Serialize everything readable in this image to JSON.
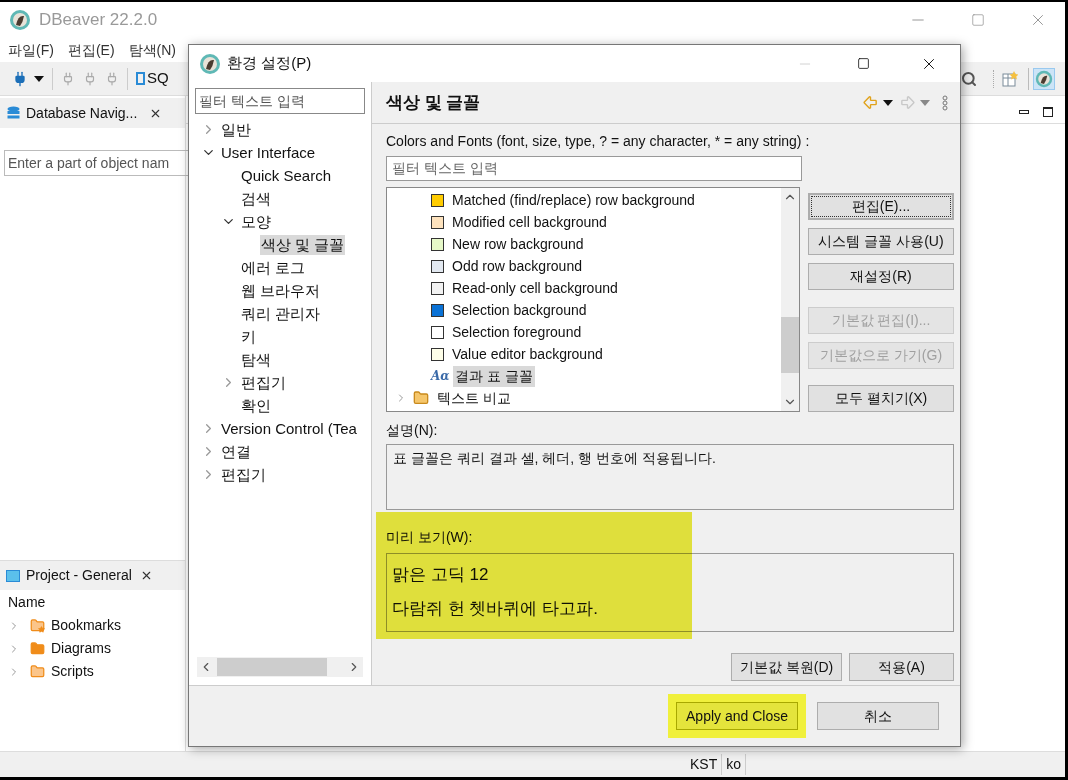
{
  "app": {
    "title": "DBeaver 22.2.0",
    "menu": [
      "파일(F)",
      "편집(E)",
      "탐색(N)"
    ],
    "toolbar_label": "SQ"
  },
  "navigator": {
    "tab": "Database Navig...",
    "filter_placeholder": "Enter a part of object nam"
  },
  "project": {
    "tab": "Project - General",
    "column": "Name",
    "items": [
      {
        "label": "Bookmarks",
        "kind": "bookmarks"
      },
      {
        "label": "Diagrams",
        "kind": "diagrams"
      },
      {
        "label": "Scripts",
        "kind": "scripts"
      }
    ]
  },
  "status_bar": [
    "KST",
    "ko"
  ],
  "dialog": {
    "title": "환경 설정(P)",
    "filter_placeholder": "필터 텍스트 입력",
    "tree": [
      {
        "label": "일반",
        "expanded": false,
        "selected": false
      },
      {
        "label": "User Interface",
        "expanded": true,
        "selected": false,
        "children": [
          {
            "label": "Quick Search",
            "selected": false
          },
          {
            "label": "검색",
            "selected": false
          },
          {
            "label": "모양",
            "expanded": true,
            "selected": false,
            "children": [
              {
                "label": "색상 및 글꼴",
                "selected": true
              }
            ]
          },
          {
            "label": "에러 로그",
            "selected": false
          },
          {
            "label": "웹 브라우저",
            "selected": false
          },
          {
            "label": "쿼리 관리자",
            "selected": false
          },
          {
            "label": "키",
            "selected": false
          },
          {
            "label": "탐색",
            "selected": false
          },
          {
            "label": "편집기",
            "expanded": false,
            "selected": false
          },
          {
            "label": "확인",
            "selected": false
          }
        ]
      },
      {
        "label": "Version Control (Tea",
        "expanded": false,
        "selected": false
      },
      {
        "label": "연결",
        "expanded": false,
        "selected": false
      },
      {
        "label": "편집기",
        "expanded": false,
        "selected": false
      }
    ],
    "page_title": "색상 및 글꼴",
    "filter_label": "Colors and Fonts (font, size, type, ? = any character, * = any string) :",
    "list_filter_placeholder": "필터 텍스트 입력",
    "items": [
      {
        "label": "Matched (find/replace) row background",
        "kind": "color",
        "color": "#ffcc00",
        "selected": false
      },
      {
        "label": "Modified cell background",
        "kind": "color",
        "color": "#fde2bd",
        "selected": false
      },
      {
        "label": "New row background",
        "kind": "color",
        "color": "#e6f8c8",
        "selected": false
      },
      {
        "label": "Odd row background",
        "kind": "color",
        "color": "#e2e8f0",
        "selected": false
      },
      {
        "label": "Read-only cell background",
        "kind": "color",
        "color": "#f2f2f2",
        "selected": false
      },
      {
        "label": "Selection background",
        "kind": "color",
        "color": "#0a72d6",
        "selected": false
      },
      {
        "label": "Selection foreground",
        "kind": "color",
        "color": "#ffffff",
        "selected": false
      },
      {
        "label": "Value editor background",
        "kind": "color",
        "color": "#fefee8",
        "selected": false
      },
      {
        "label": "결과 표 글꼴",
        "kind": "font",
        "icon": "Aα",
        "selected": true
      },
      {
        "label": "텍스트 비교",
        "kind": "folder",
        "selected": false
      }
    ],
    "side_buttons": [
      {
        "label": "편집(E)...",
        "disabled": false,
        "focused": true
      },
      {
        "label": "시스템 글꼴 사용(U)",
        "disabled": false,
        "focused": false
      },
      {
        "label": "재설정(R)",
        "disabled": false,
        "focused": false
      },
      {
        "label": "기본값 편집(I)...",
        "disabled": true,
        "focused": false
      },
      {
        "label": "기본값으로 가기(G)",
        "disabled": true,
        "focused": false
      },
      {
        "label": "모두 펼치기(X)",
        "disabled": false,
        "focused": false
      }
    ],
    "description_label": "설명(N):",
    "description": "표 글꼴은 쿼리 결과 셀, 헤더, 행 번호에 적용됩니다.",
    "preview_label": "미리 보기(W):",
    "preview_highlighted": true,
    "preview_lines": [
      "맑은 고딕 12",
      "다람쥐 헌 쳇바퀴에 타고파."
    ],
    "page_buttons": [
      "기본값 복원(D)",
      "적용(A)"
    ],
    "buttons": [
      {
        "label": "Apply and Close",
        "highlighted": true
      },
      {
        "label": "취소",
        "highlighted": false
      }
    ]
  }
}
